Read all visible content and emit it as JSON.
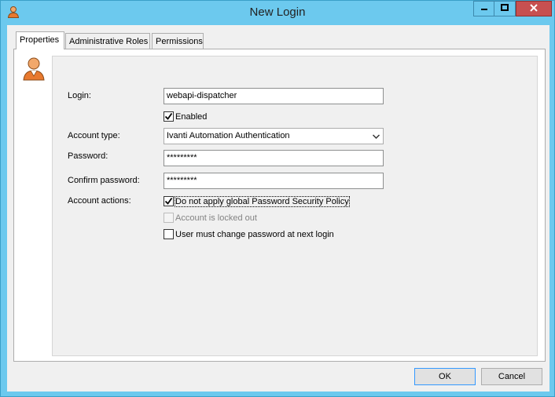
{
  "window": {
    "title": "New Login"
  },
  "tabs": [
    {
      "label": "Properties",
      "active": true
    },
    {
      "label": "Administrative Roles",
      "active": false
    },
    {
      "label": "Permissions",
      "active": false
    }
  ],
  "form": {
    "login_label": "Login:",
    "login_value": "webapi-dispatcher",
    "enabled_label": "Enabled",
    "enabled_checked": true,
    "account_type_label": "Account type:",
    "account_type_value": "Ivanti Automation Authentication",
    "password_label": "Password:",
    "password_value": "*********",
    "confirm_password_label": "Confirm password:",
    "confirm_password_value": "*********",
    "account_actions_label": "Account actions:",
    "actions": [
      {
        "label": "Do not apply global Password Security Policy",
        "checked": true,
        "disabled": false
      },
      {
        "label": "Account is locked out",
        "checked": false,
        "disabled": true
      },
      {
        "label": "User must change password at next login",
        "checked": false,
        "disabled": false
      }
    ]
  },
  "buttons": {
    "ok": "OK",
    "cancel": "Cancel"
  },
  "colors": {
    "titlebar": "#6cc9ee",
    "close": "#c75050",
    "user_icon": "#e8792f"
  },
  "icons": {
    "app": "user-icon",
    "avatar": "user-icon",
    "dropdown": "chevron-down-icon",
    "check": "check-icon"
  }
}
